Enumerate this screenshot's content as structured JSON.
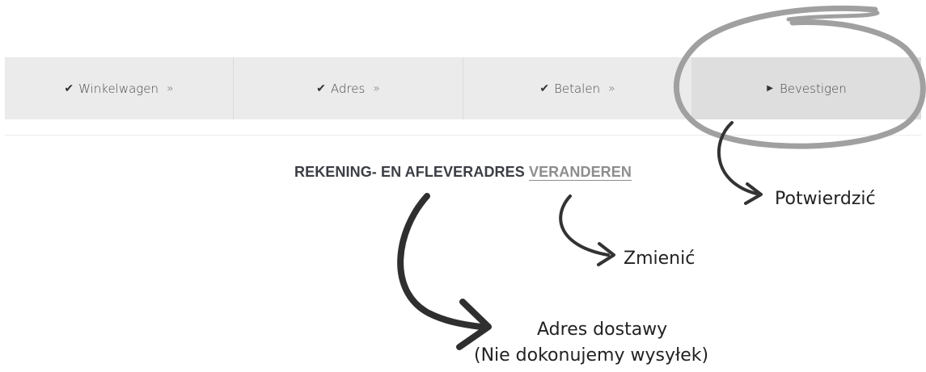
{
  "steps": [
    {
      "label": "Winkelwagen",
      "icon": "check-icon",
      "suffix": "»",
      "state": "done"
    },
    {
      "label": "Adres",
      "icon": "check-icon",
      "suffix": "»",
      "state": "done"
    },
    {
      "label": "Betalen",
      "icon": "check-icon",
      "suffix": "»",
      "state": "done"
    },
    {
      "label": "Bevestigen",
      "icon": "caret-right-icon",
      "state": "current"
    }
  ],
  "heading": {
    "text": "REKENING- EN AFLEVERADRES",
    "link": "VERANDEREN"
  },
  "annotations": {
    "confirm": "Potwierdzić",
    "change": "Zmienić",
    "delivery_line1": "Adres dostawy",
    "delivery_line2": "(Nie dokonujemy wysyłek)"
  },
  "colors": {
    "step_bg": "#ebebeb",
    "step_current_bg": "#dedede",
    "heading": "#3b3e44",
    "link": "#8d8d8d",
    "circle": "#9e9e9e"
  }
}
